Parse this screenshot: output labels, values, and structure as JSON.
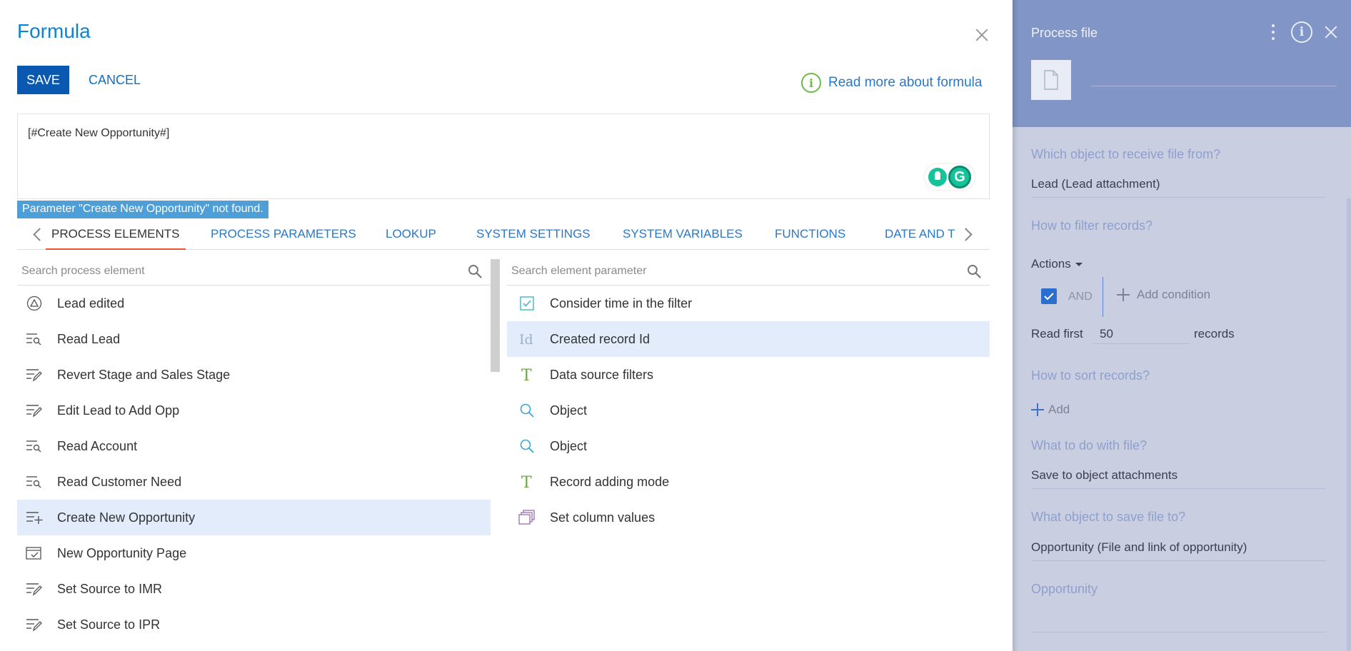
{
  "dialog": {
    "title": "Formula",
    "save_label": "SAVE",
    "cancel_label": "CANCEL",
    "read_more_label": "Read more about formula",
    "formula_value": "[#Create New Opportunity#]",
    "error_message": "Parameter \"Create New Opportunity\" not found.",
    "tabs": [
      {
        "label": "PROCESS ELEMENTS",
        "active": true
      },
      {
        "label": "PROCESS PARAMETERS",
        "active": false
      },
      {
        "label": "LOOKUP",
        "active": false
      },
      {
        "label": "SYSTEM SETTINGS",
        "active": false
      },
      {
        "label": "SYSTEM VARIABLES",
        "active": false
      },
      {
        "label": "FUNCTIONS",
        "active": false
      },
      {
        "label": "DATE AND TI",
        "active": false
      }
    ],
    "left_search_placeholder": "Search process element",
    "right_search_placeholder": "Search element parameter",
    "process_elements": [
      {
        "label": "Lead edited",
        "icon": "signal-triangle-icon",
        "selected": false
      },
      {
        "label": "Read Lead",
        "icon": "read-data-icon",
        "selected": false
      },
      {
        "label": "Revert Stage and Sales Stage",
        "icon": "edit-data-icon",
        "selected": false
      },
      {
        "label": "Edit Lead to Add Opp",
        "icon": "edit-data-icon",
        "selected": false
      },
      {
        "label": "Read Account",
        "icon": "read-data-icon",
        "selected": false
      },
      {
        "label": "Read Customer Need",
        "icon": "read-data-icon",
        "selected": false
      },
      {
        "label": "Create New Opportunity",
        "icon": "add-data-icon",
        "selected": true
      },
      {
        "label": "New Opportunity Page",
        "icon": "open-page-icon",
        "selected": false
      },
      {
        "label": "Set Source to IMR",
        "icon": "edit-data-icon",
        "selected": false
      },
      {
        "label": "Set Source to IPR",
        "icon": "edit-data-icon",
        "selected": false
      }
    ],
    "element_parameters": [
      {
        "label": "Consider time in the filter",
        "icon": "checkbox-icon",
        "selected": false
      },
      {
        "label": "Created record Id",
        "icon": "id-icon",
        "selected": true
      },
      {
        "label": "Data source filters",
        "icon": "text-type-icon",
        "selected": false
      },
      {
        "label": "Object",
        "icon": "lookup-icon",
        "selected": false
      },
      {
        "label": "Object",
        "icon": "lookup-icon",
        "selected": false
      },
      {
        "label": "Record adding mode",
        "icon": "text-type-icon",
        "selected": false
      },
      {
        "label": "Set column values",
        "icon": "collection-icon",
        "selected": false
      }
    ]
  },
  "side_panel": {
    "title": "Process file",
    "q_receive_from": "Which object to receive file from?",
    "v_receive_from": "Lead (Lead attachment)",
    "q_filter": "How to filter records?",
    "actions_label": "Actions",
    "and_label": "AND",
    "add_condition_label": "Add condition",
    "read_first_label": "Read first",
    "read_first_value": "50",
    "records_label": "records",
    "q_sort": "How to sort records?",
    "add_label": "Add",
    "q_do_with_file": "What to do with file?",
    "v_do_with_file": "Save to object attachments",
    "q_save_to": "What object to save file to?",
    "v_save_to": "Opportunity (File and link of opportunity)",
    "q_opportunity": "Opportunity"
  },
  "colors": {
    "accent_blue": "#0b58b0",
    "link_blue": "#2a78c6",
    "error_banner": "#4e9fd8",
    "active_tab_underline": "#e8552d",
    "selected_row": "#e3ecfa",
    "side_header": "#8195c6",
    "side_body": "#c9cfe0"
  }
}
